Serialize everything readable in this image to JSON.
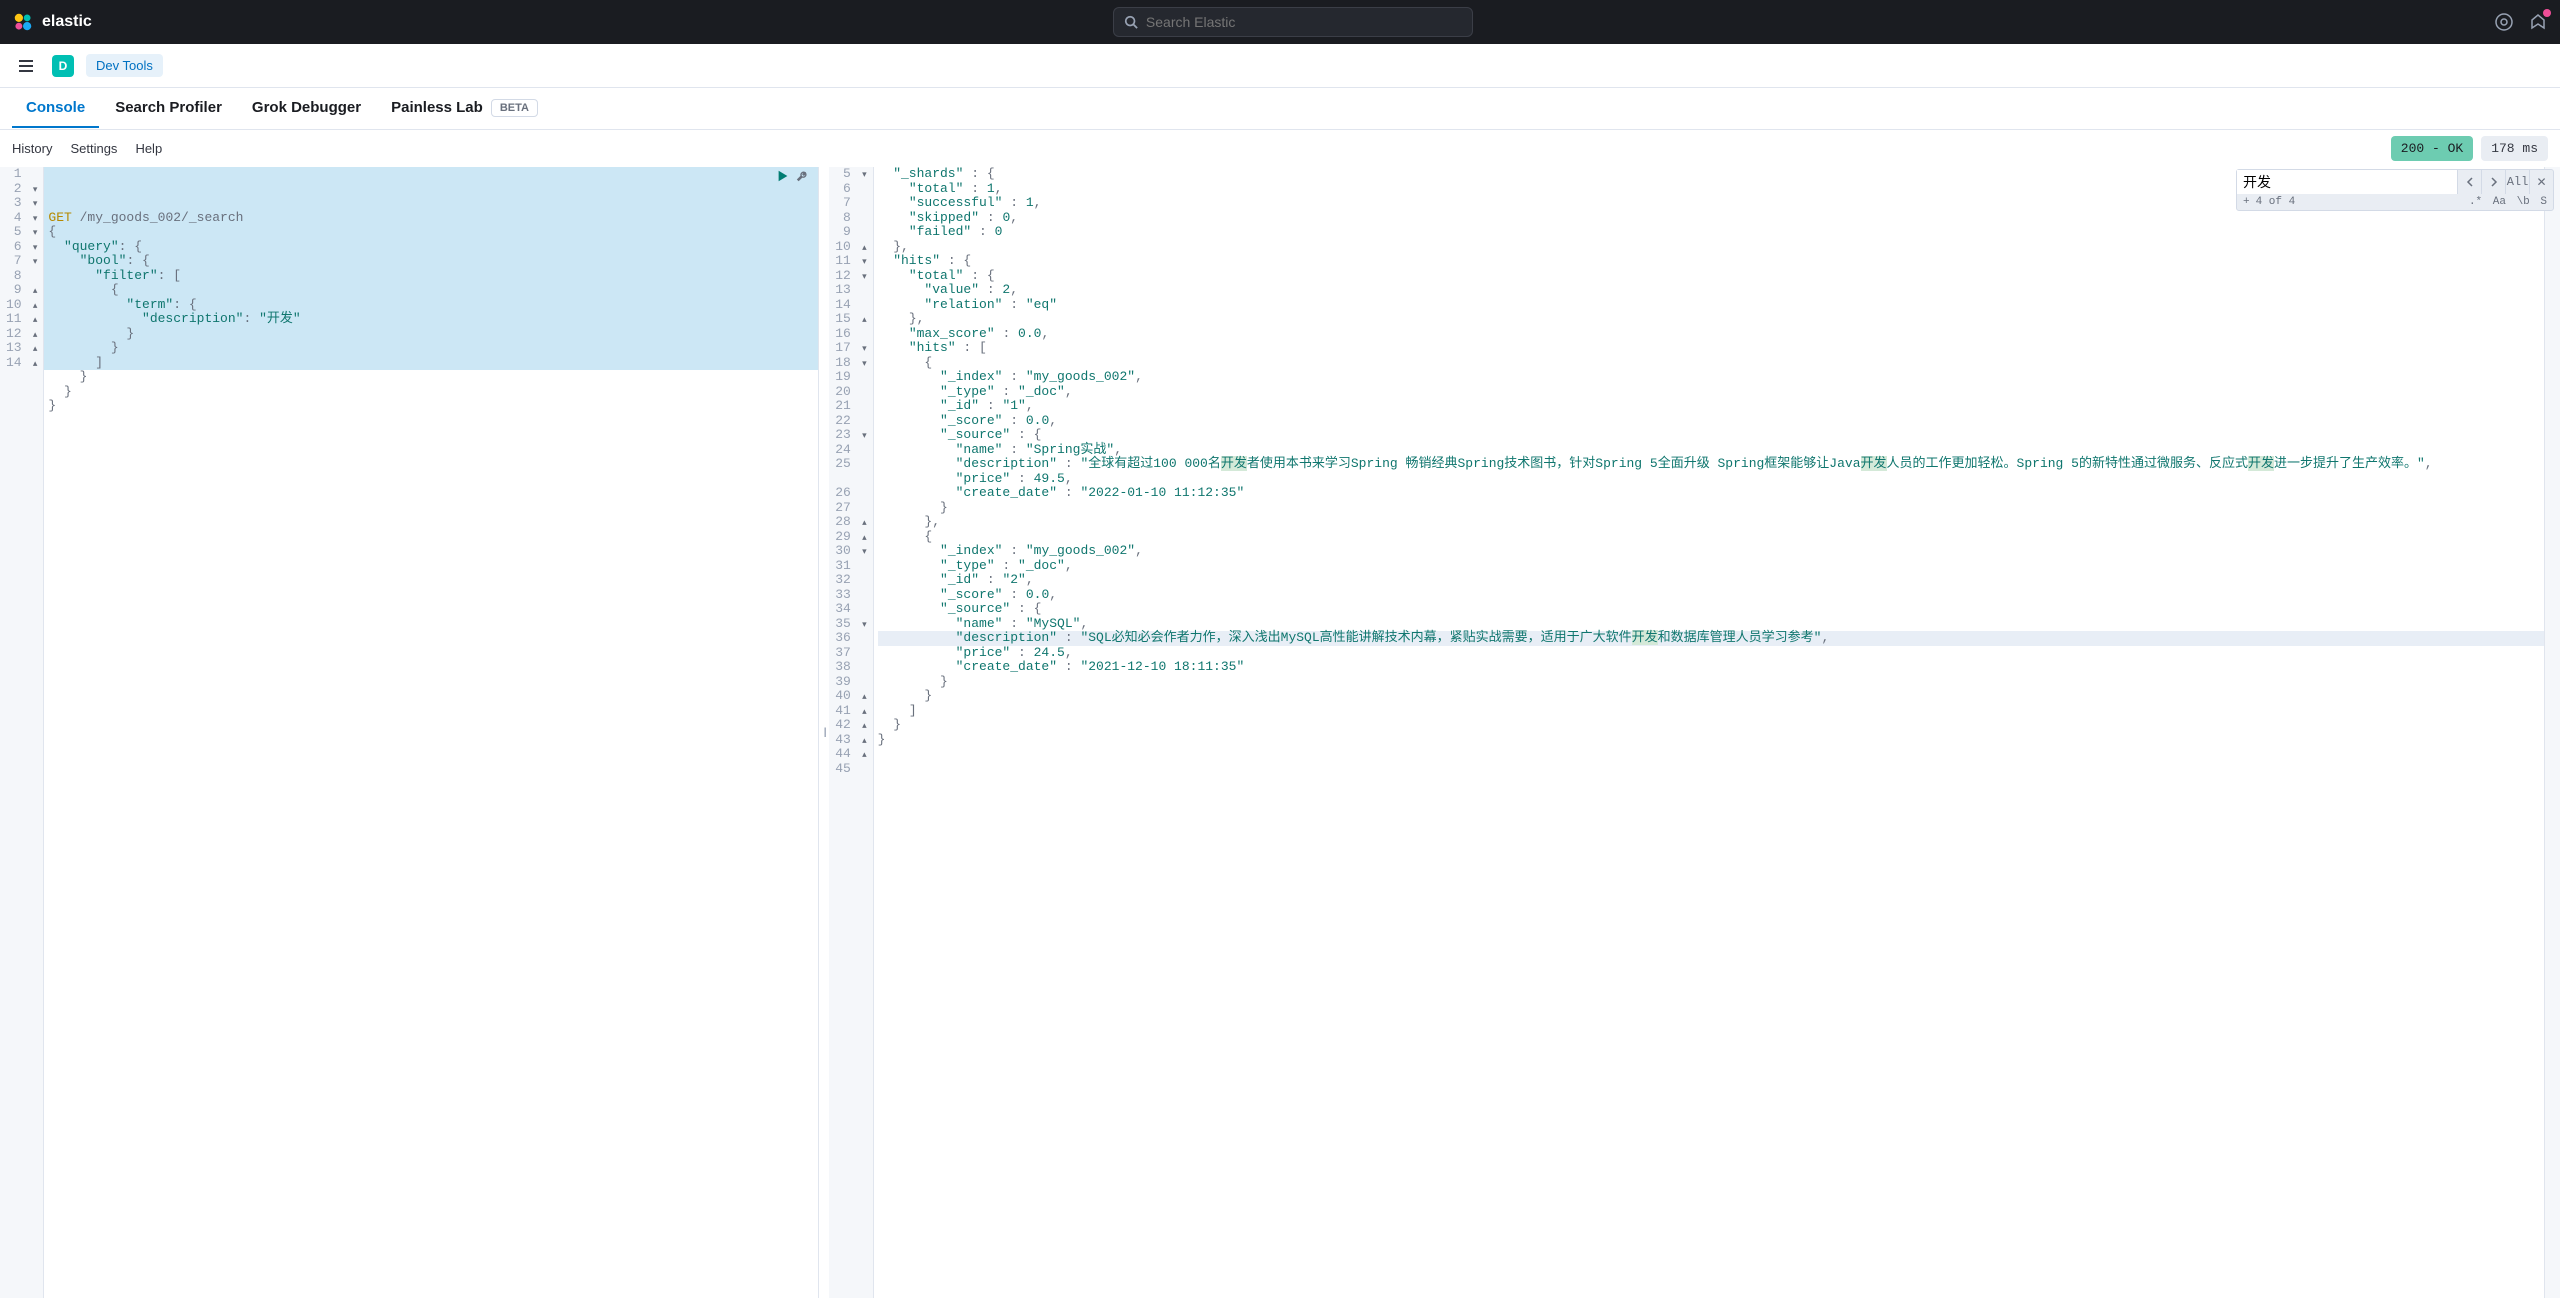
{
  "header": {
    "brand": "elastic",
    "search_placeholder": "Search Elastic"
  },
  "subheader": {
    "avatar_letter": "D",
    "devtools_label": "Dev Tools"
  },
  "tabs": {
    "console": "Console",
    "search_profiler": "Search Profiler",
    "grok_debugger": "Grok Debugger",
    "painless_lab": "Painless Lab",
    "beta": "BETA"
  },
  "toolbar": {
    "history": "History",
    "settings": "Settings",
    "help": "Help",
    "status": "200 - OK",
    "timing": "178 ms"
  },
  "find": {
    "input": "开发",
    "all": "All",
    "plus": "+",
    "counter": "4 of 4",
    "regex": ".*",
    "case": "Aa",
    "word": "\\b",
    "s": "S"
  },
  "request": {
    "method": "GET",
    "path": "/my_goods_002/_search",
    "lines": [
      {
        "n": 1,
        "fold": "",
        "t": [
          {
            "c": "kw",
            "v": "GET"
          },
          {
            "c": "",
            "v": " "
          },
          {
            "c": "endpoint",
            "v": "/my_goods_002/_search"
          }
        ]
      },
      {
        "n": 2,
        "fold": "▾",
        "t": [
          {
            "c": "punc",
            "v": "{"
          }
        ]
      },
      {
        "n": 3,
        "fold": "▾",
        "t": [
          {
            "c": "",
            "v": "  "
          },
          {
            "c": "str",
            "v": "\"query\""
          },
          {
            "c": "punc",
            "v": ": {"
          }
        ]
      },
      {
        "n": 4,
        "fold": "▾",
        "t": [
          {
            "c": "",
            "v": "    "
          },
          {
            "c": "str",
            "v": "\"bool\""
          },
          {
            "c": "punc",
            "v": ": {"
          }
        ]
      },
      {
        "n": 5,
        "fold": "▾",
        "t": [
          {
            "c": "",
            "v": "      "
          },
          {
            "c": "str",
            "v": "\"filter\""
          },
          {
            "c": "punc",
            "v": ": ["
          }
        ]
      },
      {
        "n": 6,
        "fold": "▾",
        "t": [
          {
            "c": "",
            "v": "        "
          },
          {
            "c": "punc",
            "v": "{"
          }
        ]
      },
      {
        "n": 7,
        "fold": "▾",
        "t": [
          {
            "c": "",
            "v": "          "
          },
          {
            "c": "str",
            "v": "\"term\""
          },
          {
            "c": "punc",
            "v": ": {"
          }
        ]
      },
      {
        "n": 8,
        "fold": "",
        "t": [
          {
            "c": "",
            "v": "            "
          },
          {
            "c": "str",
            "v": "\"description\""
          },
          {
            "c": "punc",
            "v": ": "
          },
          {
            "c": "str",
            "v": "\"开发\""
          }
        ]
      },
      {
        "n": 9,
        "fold": "▴",
        "t": [
          {
            "c": "",
            "v": "          "
          },
          {
            "c": "punc",
            "v": "}"
          }
        ]
      },
      {
        "n": 10,
        "fold": "▴",
        "t": [
          {
            "c": "",
            "v": "        "
          },
          {
            "c": "punc",
            "v": "}"
          }
        ]
      },
      {
        "n": 11,
        "fold": "▴",
        "t": [
          {
            "c": "",
            "v": "      "
          },
          {
            "c": "punc",
            "v": "]"
          }
        ]
      },
      {
        "n": 12,
        "fold": "▴",
        "t": [
          {
            "c": "",
            "v": "    "
          },
          {
            "c": "punc",
            "v": "}"
          }
        ]
      },
      {
        "n": 13,
        "fold": "▴",
        "t": [
          {
            "c": "",
            "v": "  "
          },
          {
            "c": "punc",
            "v": "}"
          }
        ]
      },
      {
        "n": 14,
        "fold": "▴",
        "t": [
          {
            "c": "punc",
            "v": "}"
          }
        ]
      }
    ]
  },
  "response": {
    "lines": [
      {
        "n": 5,
        "fold": "▾",
        "t": [
          {
            "c": "",
            "v": "  "
          },
          {
            "c": "str",
            "v": "\"_shards\""
          },
          {
            "c": "punc",
            "v": " : {"
          }
        ]
      },
      {
        "n": 6,
        "fold": "",
        "t": [
          {
            "c": "",
            "v": "    "
          },
          {
            "c": "str",
            "v": "\"total\""
          },
          {
            "c": "punc",
            "v": " : "
          },
          {
            "c": "num",
            "v": "1"
          },
          {
            "c": "punc",
            "v": ","
          }
        ]
      },
      {
        "n": 7,
        "fold": "",
        "t": [
          {
            "c": "",
            "v": "    "
          },
          {
            "c": "str",
            "v": "\"successful\""
          },
          {
            "c": "punc",
            "v": " : "
          },
          {
            "c": "num",
            "v": "1"
          },
          {
            "c": "punc",
            "v": ","
          }
        ]
      },
      {
        "n": 8,
        "fold": "",
        "t": [
          {
            "c": "",
            "v": "    "
          },
          {
            "c": "str",
            "v": "\"skipped\""
          },
          {
            "c": "punc",
            "v": " : "
          },
          {
            "c": "num",
            "v": "0"
          },
          {
            "c": "punc",
            "v": ","
          }
        ]
      },
      {
        "n": 9,
        "fold": "",
        "t": [
          {
            "c": "",
            "v": "    "
          },
          {
            "c": "str",
            "v": "\"failed\""
          },
          {
            "c": "punc",
            "v": " : "
          },
          {
            "c": "num",
            "v": "0"
          }
        ]
      },
      {
        "n": 10,
        "fold": "▴",
        "t": [
          {
            "c": "",
            "v": "  "
          },
          {
            "c": "punc",
            "v": "},"
          }
        ]
      },
      {
        "n": 11,
        "fold": "▾",
        "t": [
          {
            "c": "",
            "v": "  "
          },
          {
            "c": "str",
            "v": "\"hits\""
          },
          {
            "c": "punc",
            "v": " : {"
          }
        ]
      },
      {
        "n": 12,
        "fold": "▾",
        "t": [
          {
            "c": "",
            "v": "    "
          },
          {
            "c": "str",
            "v": "\"total\""
          },
          {
            "c": "punc",
            "v": " : {"
          }
        ]
      },
      {
        "n": 13,
        "fold": "",
        "t": [
          {
            "c": "",
            "v": "      "
          },
          {
            "c": "str",
            "v": "\"value\""
          },
          {
            "c": "punc",
            "v": " : "
          },
          {
            "c": "num",
            "v": "2"
          },
          {
            "c": "punc",
            "v": ","
          }
        ]
      },
      {
        "n": 14,
        "fold": "",
        "t": [
          {
            "c": "",
            "v": "      "
          },
          {
            "c": "str",
            "v": "\"relation\""
          },
          {
            "c": "punc",
            "v": " : "
          },
          {
            "c": "str",
            "v": "\"eq\""
          }
        ]
      },
      {
        "n": 15,
        "fold": "▴",
        "t": [
          {
            "c": "",
            "v": "    "
          },
          {
            "c": "punc",
            "v": "},"
          }
        ]
      },
      {
        "n": 16,
        "fold": "",
        "t": [
          {
            "c": "",
            "v": "    "
          },
          {
            "c": "str",
            "v": "\"max_score\""
          },
          {
            "c": "punc",
            "v": " : "
          },
          {
            "c": "num",
            "v": "0.0"
          },
          {
            "c": "punc",
            "v": ","
          }
        ]
      },
      {
        "n": 17,
        "fold": "▾",
        "t": [
          {
            "c": "",
            "v": "    "
          },
          {
            "c": "str",
            "v": "\"hits\""
          },
          {
            "c": "punc",
            "v": " : ["
          }
        ]
      },
      {
        "n": 18,
        "fold": "▾",
        "t": [
          {
            "c": "",
            "v": "      "
          },
          {
            "c": "punc",
            "v": "{"
          }
        ]
      },
      {
        "n": 19,
        "fold": "",
        "t": [
          {
            "c": "",
            "v": "        "
          },
          {
            "c": "str",
            "v": "\"_index\""
          },
          {
            "c": "punc",
            "v": " : "
          },
          {
            "c": "str",
            "v": "\"my_goods_002\""
          },
          {
            "c": "punc",
            "v": ","
          }
        ]
      },
      {
        "n": 20,
        "fold": "",
        "t": [
          {
            "c": "",
            "v": "        "
          },
          {
            "c": "str",
            "v": "\"_type\""
          },
          {
            "c": "punc",
            "v": " : "
          },
          {
            "c": "str",
            "v": "\"_doc\""
          },
          {
            "c": "punc",
            "v": ","
          }
        ]
      },
      {
        "n": 21,
        "fold": "",
        "t": [
          {
            "c": "",
            "v": "        "
          },
          {
            "c": "str",
            "v": "\"_id\""
          },
          {
            "c": "punc",
            "v": " : "
          },
          {
            "c": "str",
            "v": "\"1\""
          },
          {
            "c": "punc",
            "v": ","
          }
        ]
      },
      {
        "n": 22,
        "fold": "",
        "t": [
          {
            "c": "",
            "v": "        "
          },
          {
            "c": "str",
            "v": "\"_score\""
          },
          {
            "c": "punc",
            "v": " : "
          },
          {
            "c": "num",
            "v": "0.0"
          },
          {
            "c": "punc",
            "v": ","
          }
        ]
      },
      {
        "n": 23,
        "fold": "▾",
        "t": [
          {
            "c": "",
            "v": "        "
          },
          {
            "c": "str",
            "v": "\"_source\""
          },
          {
            "c": "punc",
            "v": " : {"
          }
        ]
      },
      {
        "n": 24,
        "fold": "",
        "t": [
          {
            "c": "",
            "v": "          "
          },
          {
            "c": "str",
            "v": "\"name\""
          },
          {
            "c": "punc",
            "v": " : "
          },
          {
            "c": "str",
            "v": "\"Spring实战\""
          },
          {
            "c": "punc",
            "v": ","
          }
        ]
      },
      {
        "n": 25,
        "fold": "",
        "wrap": true,
        "t": [
          {
            "c": "",
            "v": "          "
          },
          {
            "c": "str",
            "v": "\"description\""
          },
          {
            "c": "punc",
            "v": " : "
          },
          {
            "c": "str",
            "v": "\"全球有超过100 000名"
          },
          {
            "c": "str search-hl",
            "v": "开发"
          },
          {
            "c": "str",
            "v": "者使用本书来学习Spring 畅销经典Spring技术图书，针对Spring 5全面升级 Spring框架能够让Java"
          },
          {
            "c": "str search-hl",
            "v": "开发"
          },
          {
            "c": "str",
            "v": "人员的工作更加轻松。Spring 5的新特性通过微服务、反应式"
          },
          {
            "c": "str search-hl",
            "v": "开发"
          },
          {
            "c": "str",
            "v": "进一步提升了生产效率。\""
          },
          {
            "c": "punc",
            "v": ","
          }
        ]
      },
      {
        "n": 26,
        "fold": "",
        "t": [
          {
            "c": "",
            "v": "          "
          },
          {
            "c": "str",
            "v": "\"price\""
          },
          {
            "c": "punc",
            "v": " : "
          },
          {
            "c": "num",
            "v": "49.5"
          },
          {
            "c": "punc",
            "v": ","
          }
        ]
      },
      {
        "n": 27,
        "fold": "",
        "t": [
          {
            "c": "",
            "v": "          "
          },
          {
            "c": "str",
            "v": "\"create_date\""
          },
          {
            "c": "punc",
            "v": " : "
          },
          {
            "c": "str",
            "v": "\"2022-01-10 11:12:35\""
          }
        ]
      },
      {
        "n": 28,
        "fold": "▴",
        "t": [
          {
            "c": "",
            "v": "        "
          },
          {
            "c": "punc",
            "v": "}"
          }
        ]
      },
      {
        "n": 29,
        "fold": "▴",
        "t": [
          {
            "c": "",
            "v": "      "
          },
          {
            "c": "punc",
            "v": "},"
          }
        ]
      },
      {
        "n": 30,
        "fold": "▾",
        "t": [
          {
            "c": "",
            "v": "      "
          },
          {
            "c": "punc",
            "v": "{"
          }
        ]
      },
      {
        "n": 31,
        "fold": "",
        "t": [
          {
            "c": "",
            "v": "        "
          },
          {
            "c": "str",
            "v": "\"_index\""
          },
          {
            "c": "punc",
            "v": " : "
          },
          {
            "c": "str",
            "v": "\"my_goods_002\""
          },
          {
            "c": "punc",
            "v": ","
          }
        ]
      },
      {
        "n": 32,
        "fold": "",
        "t": [
          {
            "c": "",
            "v": "        "
          },
          {
            "c": "str",
            "v": "\"_type\""
          },
          {
            "c": "punc",
            "v": " : "
          },
          {
            "c": "str",
            "v": "\"_doc\""
          },
          {
            "c": "punc",
            "v": ","
          }
        ]
      },
      {
        "n": 33,
        "fold": "",
        "t": [
          {
            "c": "",
            "v": "        "
          },
          {
            "c": "str",
            "v": "\"_id\""
          },
          {
            "c": "punc",
            "v": " : "
          },
          {
            "c": "str",
            "v": "\"2\""
          },
          {
            "c": "punc",
            "v": ","
          }
        ]
      },
      {
        "n": 34,
        "fold": "",
        "t": [
          {
            "c": "",
            "v": "        "
          },
          {
            "c": "str",
            "v": "\"_score\""
          },
          {
            "c": "punc",
            "v": " : "
          },
          {
            "c": "num",
            "v": "0.0"
          },
          {
            "c": "punc",
            "v": ","
          }
        ]
      },
      {
        "n": 35,
        "fold": "▾",
        "t": [
          {
            "c": "",
            "v": "        "
          },
          {
            "c": "str",
            "v": "\"_source\""
          },
          {
            "c": "punc",
            "v": " : {"
          }
        ]
      },
      {
        "n": 36,
        "fold": "",
        "t": [
          {
            "c": "",
            "v": "          "
          },
          {
            "c": "str",
            "v": "\"name\""
          },
          {
            "c": "punc",
            "v": " : "
          },
          {
            "c": "str",
            "v": "\"MySQL\""
          },
          {
            "c": "punc",
            "v": ","
          }
        ]
      },
      {
        "n": 37,
        "fold": "",
        "current": true,
        "t": [
          {
            "c": "",
            "v": "          "
          },
          {
            "c": "str",
            "v": "\"description\""
          },
          {
            "c": "punc",
            "v": " : "
          },
          {
            "c": "str",
            "v": "\"SQL必知必会作者力作，深入浅出MySQL高性能讲解技术内幕，紧贴实战需要，适用于广大软件"
          },
          {
            "c": "str search-hl",
            "v": "开发"
          },
          {
            "c": "str",
            "v": "和数据库管理人员学习参考\""
          },
          {
            "c": "punc",
            "v": ","
          }
        ]
      },
      {
        "n": 38,
        "fold": "",
        "t": [
          {
            "c": "",
            "v": "          "
          },
          {
            "c": "str",
            "v": "\"price\""
          },
          {
            "c": "punc",
            "v": " : "
          },
          {
            "c": "num",
            "v": "24.5"
          },
          {
            "c": "punc",
            "v": ","
          }
        ]
      },
      {
        "n": 39,
        "fold": "",
        "t": [
          {
            "c": "",
            "v": "          "
          },
          {
            "c": "str",
            "v": "\"create_date\""
          },
          {
            "c": "punc",
            "v": " : "
          },
          {
            "c": "str",
            "v": "\"2021-12-10 18:11:35\""
          }
        ]
      },
      {
        "n": 40,
        "fold": "▴",
        "t": [
          {
            "c": "",
            "v": "        "
          },
          {
            "c": "punc",
            "v": "}"
          }
        ]
      },
      {
        "n": 41,
        "fold": "▴",
        "t": [
          {
            "c": "",
            "v": "      "
          },
          {
            "c": "punc",
            "v": "}"
          }
        ]
      },
      {
        "n": 42,
        "fold": "▴",
        "t": [
          {
            "c": "",
            "v": "    "
          },
          {
            "c": "punc",
            "v": "]"
          }
        ]
      },
      {
        "n": 43,
        "fold": "▴",
        "t": [
          {
            "c": "",
            "v": "  "
          },
          {
            "c": "punc",
            "v": "}"
          }
        ]
      },
      {
        "n": 44,
        "fold": "▴",
        "t": [
          {
            "c": "punc",
            "v": "}"
          }
        ]
      },
      {
        "n": 45,
        "fold": "",
        "t": []
      }
    ]
  }
}
